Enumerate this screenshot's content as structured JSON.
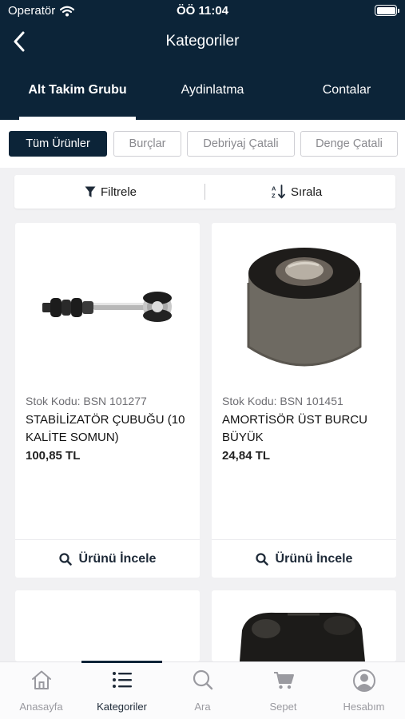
{
  "status_bar": {
    "carrier": "Operatör",
    "time": "ÖÖ 11:04"
  },
  "navbar": {
    "title": "Kategoriler"
  },
  "tabs": [
    {
      "label": "Alt Takim Grubu",
      "active": true
    },
    {
      "label": "Aydinlatma",
      "active": false
    },
    {
      "label": "Contalar",
      "active": false
    }
  ],
  "chips": [
    {
      "label": "Tüm Ürünler",
      "active": true
    },
    {
      "label": "Burçlar",
      "active": false
    },
    {
      "label": "Debriyaj Çatali",
      "active": false
    },
    {
      "label": "Denge Çatali",
      "active": false
    }
  ],
  "toolbar": {
    "filter_label": "Filtrele",
    "sort_label": "Sırala"
  },
  "products": [
    {
      "code": "Stok Kodu: BSN 101277",
      "name": "STABİLİZATÖR ÇUBUĞU (10 KALİTE SOMUN)",
      "price": "100,85 TL",
      "action": "Ürünü İncele",
      "image": "stabilizer-link"
    },
    {
      "code": "Stok Kodu: BSN 101451",
      "name": "AMORTİSÖR ÜST BURCU BÜYÜK",
      "price": "24,84 TL",
      "action": "Ürünü İncele",
      "image": "rubber-bushing"
    }
  ],
  "bottom_tabs": [
    {
      "label": "Anasayfa",
      "icon": "home-icon",
      "active": false
    },
    {
      "label": "Kategoriler",
      "icon": "list-icon",
      "active": true
    },
    {
      "label": "Ara",
      "icon": "search-icon",
      "active": false
    },
    {
      "label": "Sepet",
      "icon": "cart-icon",
      "active": false
    },
    {
      "label": "Hesabım",
      "icon": "account-icon",
      "active": false
    }
  ],
  "colors": {
    "primary": "#0c2438",
    "background": "#f1f1f3",
    "inactive": "#9a9aa0"
  }
}
